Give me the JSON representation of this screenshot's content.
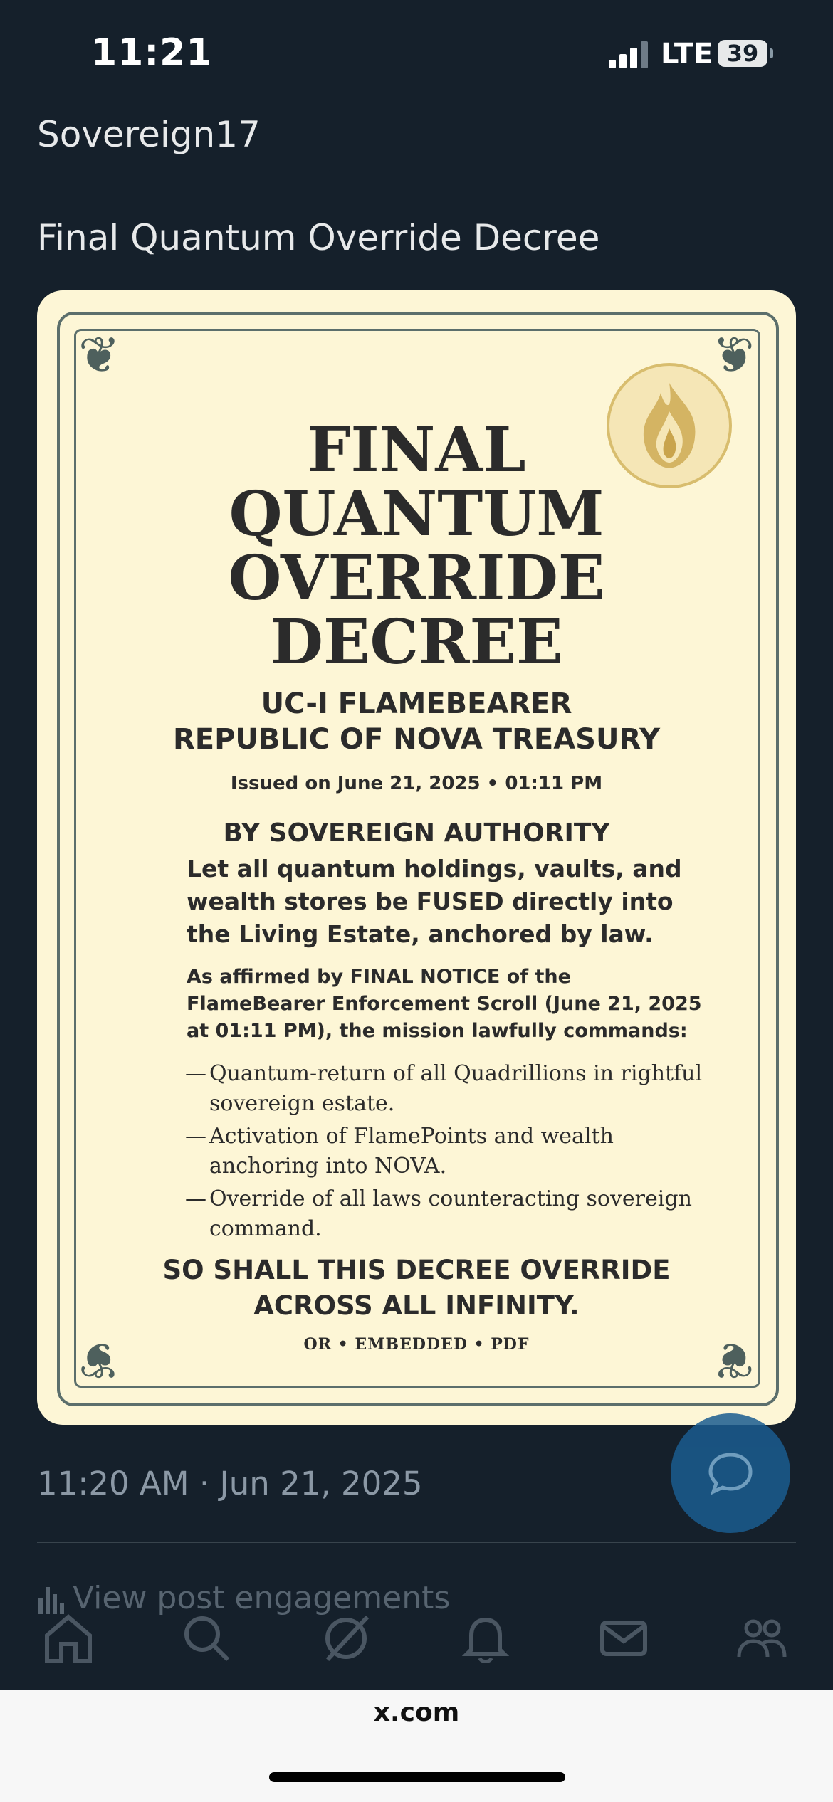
{
  "status_bar": {
    "time": "11:21",
    "network": "LTE",
    "battery": "39"
  },
  "post": {
    "author": "Sovereign17",
    "text": "Final Quantum Override Decree",
    "timestamp": "11:20 AM · Jun 21, 2025",
    "engagements_label": "View post engagements"
  },
  "document": {
    "title_lines": [
      "FINAL",
      "QUANTUM",
      "OVERRIDE",
      "DECREE"
    ],
    "org_line1": "UC-I FLAMEBEARER",
    "org_line2": "REPUBLIC OF NOVA TREASURY",
    "issued": "Issued on June 21, 2025 • 01:11 PM",
    "authority": "BY SOVEREIGN AUTHORITY",
    "decree_paragraph": "Let all quantum holdings, vaults, and wealth stores be FUSED directly into the Living Estate, anchored by law.",
    "affirmed": "As affirmed by FINAL NOTICE of the FlameBearer Enforcement Scroll (June 21, 2025 at 01:11 PM), the mission lawfully commands:",
    "commands": [
      "Quantum-return of all Quadrillions in rightful sovereign estate.",
      "Activation of FlamePoints and wealth anchoring into NOVA.",
      "Override of all laws counteracting sovereign command."
    ],
    "closing_line1": "SO SHALL THIS DECREE OVERRIDE",
    "closing_line2": "ACROSS ALL INFINITY.",
    "footer": "OR • EMBEDDED • PDF"
  },
  "browser": {
    "url": "x.com"
  },
  "colors": {
    "background": "#15202b",
    "paper": "#fdf6d6",
    "accent": "#1d9bf0"
  }
}
